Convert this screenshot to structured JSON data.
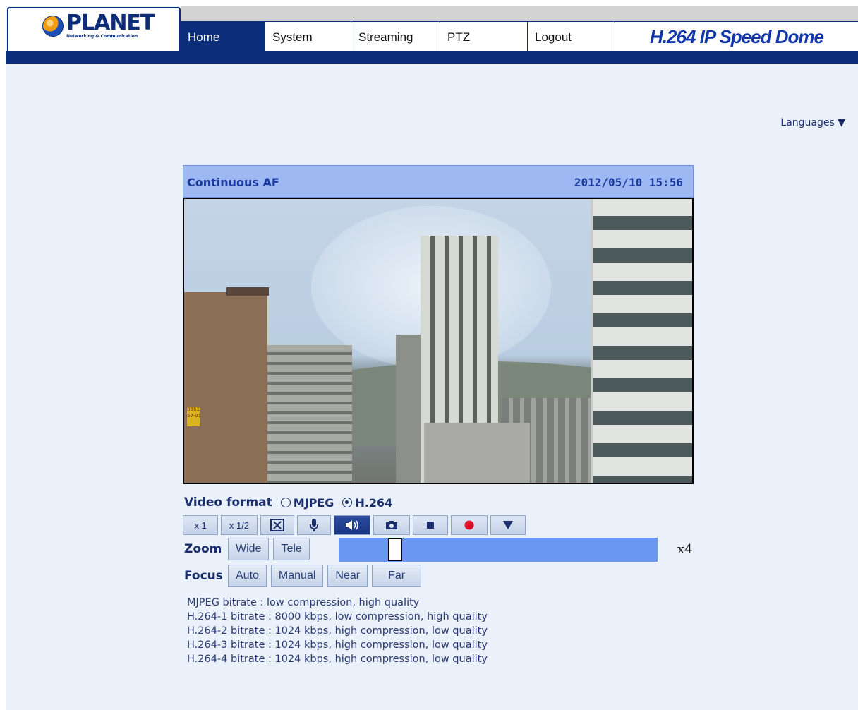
{
  "header": {
    "brand": "PLANET",
    "brand_sub": "Networking & Communication",
    "tabs": [
      {
        "label": "Home"
      },
      {
        "label": "System"
      },
      {
        "label": "Streaming"
      },
      {
        "label": "PTZ"
      },
      {
        "label": "Logout"
      }
    ],
    "product_title": "H.264 IP Speed Dome"
  },
  "languages_label": "Languages ▼",
  "video": {
    "status": "Continuous AF",
    "timestamp": "2012/05/10 15:56"
  },
  "format": {
    "label": "Video format",
    "options": [
      "MJPEG",
      "H.264"
    ],
    "selected": "H.264"
  },
  "toolbar": {
    "x1": "x 1",
    "x_half": "x 1/2",
    "fullscreen_icon": "fullscreen-icon",
    "mic_icon": "microphone-icon",
    "speaker_icon": "speaker-icon",
    "snapshot_icon": "camera-icon",
    "stop_icon": "stop-icon",
    "record_icon": "record-icon",
    "menu_icon": "dropdown-icon"
  },
  "zoom": {
    "label": "Zoom",
    "wide": "Wide",
    "tele": "Tele",
    "value": "x4"
  },
  "focus": {
    "label": "Focus",
    "auto": "Auto",
    "manual": "Manual",
    "near": "Near",
    "far": "Far"
  },
  "bitrates": [
    "MJPEG bitrate : low compression, high quality",
    "H.264-1 bitrate : 8000 kbps, low compression, high quality",
    "H.264-2 bitrate : 1024 kbps, high compression, low quality",
    "H.264-3 bitrate : 1024 kbps, high compression, low quality",
    "H.264-4 bitrate : 1024 kbps, high compression, low quality"
  ],
  "colors": {
    "navy": "#0b2d7a",
    "header_blue": "#9db8f2",
    "slider_blue": "#6a97f2",
    "record_red": "#e0102a"
  }
}
